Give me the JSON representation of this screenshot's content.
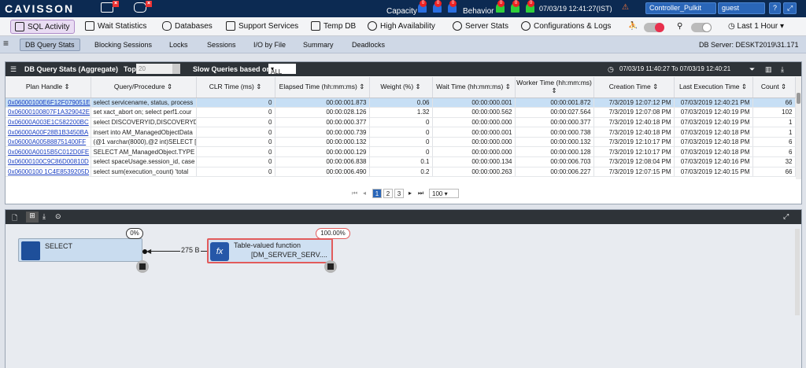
{
  "app": {
    "logo": "CAVISSON",
    "capacity_label": "Capacity",
    "behavior_label": "Behavior",
    "datetime": "07/03/19 12:41:27(IST)",
    "controller": "Controller_Pulkit",
    "user": "guest",
    "help": "?",
    "bell_counts": [
      "0",
      "0",
      "0",
      "0",
      "0",
      "0"
    ]
  },
  "menu": {
    "items": [
      "SQL Activity",
      "Wait Statistics",
      "Databases",
      "Support Services",
      "Temp DB",
      "High Availability",
      "Server Stats",
      "Configurations & Logs"
    ],
    "time_range": "Last 1 Hour"
  },
  "subtabs": {
    "items": [
      "DB Query Stats",
      "Blocking Sessions",
      "Locks",
      "Sessions",
      "I/O by File",
      "Summary",
      "Deadlocks"
    ],
    "db_server": "DB Server: DESKT2019\\31.171"
  },
  "panel": {
    "title": "DB Query Stats (Aggregate)",
    "top_label": "Top",
    "top_value": "20",
    "slow_label": "Slow Queries based on",
    "slow_value": "ALL",
    "range": "07/03/19 11:40:27 To 07/03/19 12:40:21"
  },
  "table": {
    "headers": [
      "Plan Handle ⇕",
      "Query/Procedure ⇕",
      "CLR Time (ms) ⇕",
      "Elapsed Time (hh:mm:ms) ⇕",
      "Weight (%) ⇕",
      "Wait Time (hh:mm:ms) ⇕",
      "Worker Time (hh:mm:ms) ⇕",
      "Creation Time ⇕",
      "Last Execution Time ⇕",
      "Count ⇕"
    ],
    "rows": [
      [
        "0x06000100E6F12F079051E",
        "select servicename, status, process",
        "0",
        "00:00:001.873",
        "0.06",
        "00:00:000.001",
        "00:00:001.872",
        "7/3/2019 12:07:12 PM",
        "07/03/2019 12:40:21 PM",
        "66"
      ],
      [
        "0x06000100807F1A329042E",
        "set xact_abort on; select perf1.cour",
        "0",
        "00:00:028.126",
        "1.32",
        "00:00:000.562",
        "00:00:027.564",
        "7/3/2019 12:07:08 PM",
        "07/03/2019 12:40:19 PM",
        "102"
      ],
      [
        "0x06000A003E1C582200BC",
        "select DISCOVERYID,DISCOVERYDE",
        "0",
        "00:00:000.377",
        "0",
        "00:00:000.000",
        "00:00:000.377",
        "7/3/2019 12:40:18 PM",
        "07/03/2019 12:40:19 PM",
        "1"
      ],
      [
        "0x06000A00F28B1B3450BA",
        "insert into AM_ManagedObjectData",
        "0",
        "00:00:000.739",
        "0",
        "00:00:000.001",
        "00:00:000.738",
        "7/3/2019 12:40:18 PM",
        "07/03/2019 12:40:18 PM",
        "1"
      ],
      [
        "0x06000A005888751400FF",
        "(@1 varchar(8000),@2 int)SELECT [",
        "0",
        "00:00:000.132",
        "0",
        "00:00:000.000",
        "00:00:000.132",
        "7/3/2019 12:10:17 PM",
        "07/03/2019 12:40:18 PM",
        "6"
      ],
      [
        "0x06000A0015B5C012D0FE",
        "SELECT AM_ManagedObject.TYPE",
        "0",
        "00:00:000.129",
        "0",
        "00:00:000.000",
        "00:00:000.128",
        "7/3/2019 12:10:17 PM",
        "07/03/2019 12:40:18 PM",
        "6"
      ],
      [
        "0x06000100C9C86D00810D",
        "select spaceUsage.session_id, case",
        "0",
        "00:00:006.838",
        "0.1",
        "00:00:000.134",
        "00:00:006.703",
        "7/3/2019 12:08:04 PM",
        "07/03/2019 12:40:16 PM",
        "32"
      ],
      [
        "0x06000100 1C4E8539205D",
        "select sum(execution_count) 'total",
        "0",
        "00:00:006.490",
        "0.2",
        "00:00:000.263",
        "00:00:006.227",
        "7/3/2019 12:07:15 PM",
        "07/03/2019 12:40:15 PM",
        "66"
      ]
    ]
  },
  "pager": {
    "pages": [
      "1",
      "2",
      "3"
    ],
    "page_size": "100"
  },
  "plan": {
    "select_label": "SELECT",
    "select_pct": "0%",
    "edge_label": "275 B",
    "fn_title": "Table-valued function",
    "fn_sub": "[DM_SERVER_SERV....",
    "fn_pct": "100.00%"
  },
  "colors": {
    "topbar": "#0c2a52",
    "accent": "#2a66b8",
    "highlight_row": "#c7dff5",
    "fn_border": "#e25b5b"
  }
}
